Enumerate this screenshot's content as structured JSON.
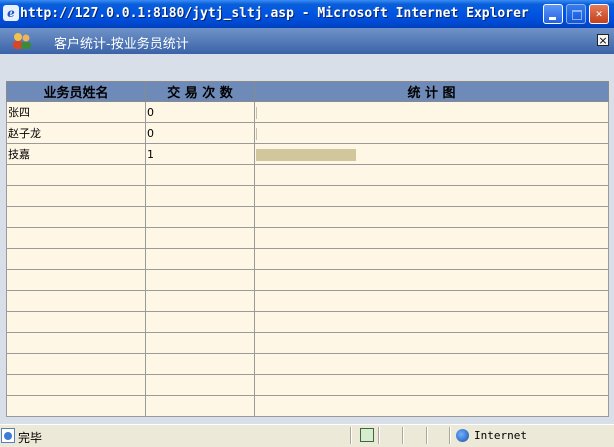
{
  "window": {
    "title": "http://127.0.0.1:8180/jytj_sltj.asp - Microsoft Internet Explorer",
    "min_icon": "minimize-icon",
    "max_icon": "maximize-icon",
    "close_label": "✕"
  },
  "panel": {
    "title": "客户统计-按业务员统计",
    "close_label": "×"
  },
  "table": {
    "headers": [
      "业务员姓名",
      "交 易 次 数",
      "统 计 图"
    ],
    "rows": [
      {
        "name": "张四",
        "count": "0",
        "bar_fraction": 0
      },
      {
        "name": "赵子龙",
        "count": "0",
        "bar_fraction": 0
      },
      {
        "name": "技嘉",
        "count": "1",
        "bar_fraction": 1
      }
    ],
    "empty_rows": 12,
    "bar_color": "#d2c79c"
  },
  "status": {
    "text": "完毕",
    "zone": "Internet"
  }
}
